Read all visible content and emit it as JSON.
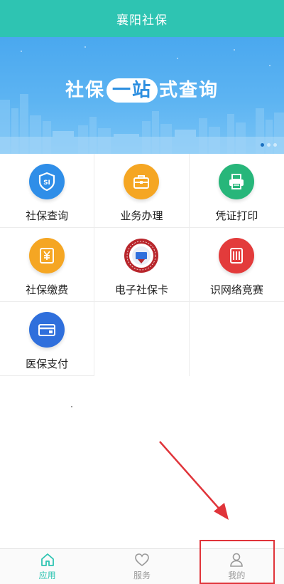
{
  "header": {
    "title": "襄阳社保"
  },
  "banner": {
    "slogan_part1": "社保",
    "slogan_pill": "一站",
    "slogan_part2": "式查询",
    "active_slide": 1,
    "slide_count": 3
  },
  "services": [
    {
      "label": "社保查询",
      "icon": "si-shield-icon",
      "color": "#2f8ee8"
    },
    {
      "label": "业务办理",
      "icon": "briefcase-icon",
      "color": "#f5a623"
    },
    {
      "label": "凭证打印",
      "icon": "printer-icon",
      "color": "#27b67a"
    },
    {
      "label": "社保缴费",
      "icon": "yen-receipt-icon",
      "color": "#f5a623"
    },
    {
      "label": "电子社保卡",
      "icon": "social-security-card-badge-icon",
      "color": "#b8262c"
    },
    {
      "label": "识网络竞赛",
      "icon": "notebook-icon",
      "color": "#e33b3b"
    },
    {
      "label": "医保支付",
      "icon": "credit-card-icon",
      "color": "#2f6fdc"
    }
  ],
  "tabbar": {
    "items": [
      {
        "label": "应用",
        "icon": "home-icon",
        "active": true
      },
      {
        "label": "服务",
        "icon": "heart-icon",
        "active": false
      },
      {
        "label": "我的",
        "icon": "user-icon",
        "active": false
      }
    ]
  },
  "annotation": {
    "color": "#e0343a",
    "target": "我的"
  }
}
